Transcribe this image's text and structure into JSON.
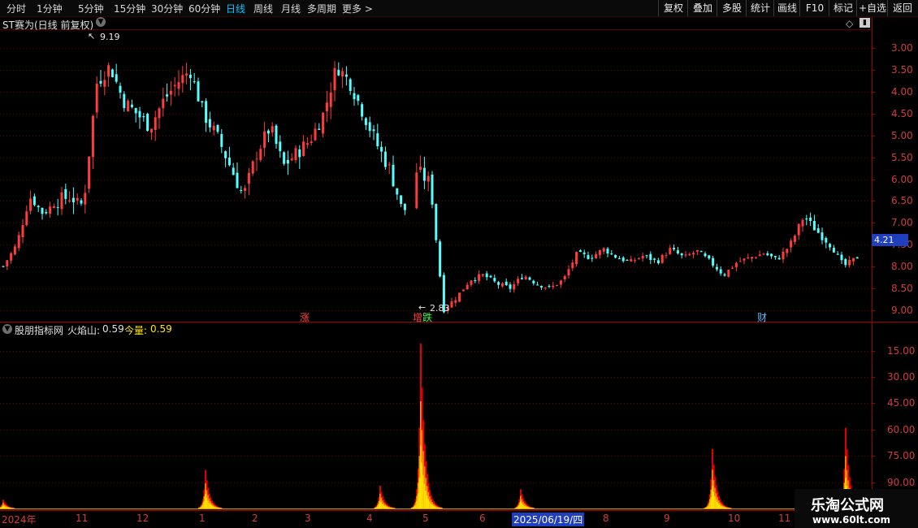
{
  "toolbar": {
    "periods": [
      "分时",
      "1分钟",
      "5分钟",
      "15分钟",
      "30分钟",
      "60分钟",
      "日线",
      "周线",
      "月线",
      "多周期",
      "更多 >"
    ],
    "active_period": "日线",
    "right_buttons": [
      "复权",
      "叠加",
      "多股",
      "统计",
      "画线",
      "F10",
      "标记",
      "+自选",
      "返回"
    ]
  },
  "main_panel": {
    "title": "ST赛为(日线 前复权)",
    "high_label": "9.19",
    "low_label": "2.83",
    "current_price": "4.21",
    "y_ticks": [
      "9.00",
      "8.50",
      "8.00",
      "7.50",
      "7.00",
      "6.50",
      "6.00",
      "5.50",
      "5.00",
      "4.50",
      "4.00",
      "3.50",
      "3.00"
    ],
    "event_markers": [
      "涨",
      "增",
      "跌",
      "财"
    ]
  },
  "indicator_panel": {
    "title": "股朋指标网",
    "line1_name": "火焰山:",
    "line1_value": "0.59",
    "line2_name": "今量:",
    "line2_value": "0.59",
    "y_ticks": [
      "90.00",
      "75.00",
      "60.00",
      "45.00",
      "30.00",
      "15.00"
    ]
  },
  "x_axis": {
    "labels": [
      "2024年",
      "11",
      "12",
      "1",
      "2",
      "3",
      "4",
      "5",
      "6",
      "2025/06/19/四",
      "8",
      "9",
      "10",
      "11"
    ]
  },
  "watermark": {
    "title": "乐淘公式网",
    "url": "www.60lt.com"
  },
  "colors": {
    "up": "#ff3c3c",
    "down": "#54ffff",
    "grid": "#6a0000",
    "current_price_bg": "#1f3fbf",
    "flame_red": "#e00000",
    "flame_orange": "#ff8c00",
    "flame_yellow": "#ffe600"
  },
  "icons": [
    "chevron-down-icon",
    "diamond-icon",
    "panel-toggle-icon",
    "collapse-icon"
  ],
  "chart_data": [
    {
      "type": "candlestick",
      "title": "ST赛为(日线 前复权)",
      "x_range": [
        "2024-10",
        "2025-11"
      ],
      "ylim": [
        2.75,
        9.4
      ],
      "y_ticks": [
        3.0,
        3.5,
        4.0,
        4.5,
        5.0,
        5.5,
        6.0,
        6.5,
        7.0,
        7.5,
        8.0,
        8.5,
        9.0
      ],
      "annotations": [
        {
          "text": "9.19",
          "kind": "period high"
        },
        {
          "text": "2.83",
          "kind": "period low"
        }
      ],
      "last_price": 4.21,
      "close_path": [
        {
          "x": "2024-10",
          "y": 4.0
        },
        {
          "x": "2024-10",
          "y": 4.5
        },
        {
          "x": "2024-10",
          "y": 5.6
        },
        {
          "x": "2024-10",
          "y": 5.2
        },
        {
          "x": "2024-10",
          "y": 5.5
        },
        {
          "x": "2024-11",
          "y": 5.6
        },
        {
          "x": "2024-11",
          "y": 5.4
        },
        {
          "x": "2024-11",
          "y": 8.2
        },
        {
          "x": "2024-11",
          "y": 8.6
        },
        {
          "x": "2024-11",
          "y": 7.8
        },
        {
          "x": "2024-12",
          "y": 7.5
        },
        {
          "x": "2024-12",
          "y": 7.2
        },
        {
          "x": "2024-12",
          "y": 7.8
        },
        {
          "x": "2024-12",
          "y": 8.2
        },
        {
          "x": "2025-01",
          "y": 8.5
        },
        {
          "x": "2025-01",
          "y": 7.5
        },
        {
          "x": "2025-01",
          "y": 7.0
        },
        {
          "x": "2025-01",
          "y": 6.3
        },
        {
          "x": "2025-02",
          "y": 5.6
        },
        {
          "x": "2025-02",
          "y": 6.6
        },
        {
          "x": "2025-02",
          "y": 7.2
        },
        {
          "x": "2025-02",
          "y": 6.3
        },
        {
          "x": "2025-02",
          "y": 6.6
        },
        {
          "x": "2025-03",
          "y": 6.9
        },
        {
          "x": "2025-03",
          "y": 7.5
        },
        {
          "x": "2025-03",
          "y": 8.6
        },
        {
          "x": "2025-03",
          "y": 8.2
        },
        {
          "x": "2025-04",
          "y": 7.5
        },
        {
          "x": "2025-04",
          "y": 6.8
        },
        {
          "x": "2025-04",
          "y": 6.2
        },
        {
          "x": "2025-04",
          "y": 5.2
        },
        {
          "x": "2025-04",
          "y": 6.2
        },
        {
          "x": "2025-04",
          "y": 5.9
        },
        {
          "x": "2025-05",
          "y": 3.0
        },
        {
          "x": "2025-05",
          "y": 3.3
        },
        {
          "x": "2025-05",
          "y": 3.7
        },
        {
          "x": "2025-05",
          "y": 3.8
        },
        {
          "x": "2025-06",
          "y": 3.6
        },
        {
          "x": "2025-06",
          "y": 3.5
        },
        {
          "x": "2025-06",
          "y": 3.8
        },
        {
          "x": "2025-06",
          "y": 3.6
        },
        {
          "x": "2025-06",
          "y": 3.5
        },
        {
          "x": "2025-07",
          "y": 3.7
        },
        {
          "x": "2025-07",
          "y": 4.3
        },
        {
          "x": "2025-07",
          "y": 4.2
        },
        {
          "x": "2025-07",
          "y": 4.4
        },
        {
          "x": "2025-07",
          "y": 4.2
        },
        {
          "x": "2025-08",
          "y": 4.1
        },
        {
          "x": "2025-08",
          "y": 4.25
        },
        {
          "x": "2025-08",
          "y": 4.1
        },
        {
          "x": "2025-08",
          "y": 4.4
        },
        {
          "x": "2025-09",
          "y": 4.2
        },
        {
          "x": "2025-09",
          "y": 4.35
        },
        {
          "x": "2025-09",
          "y": 4.1
        },
        {
          "x": "2025-09",
          "y": 3.8
        },
        {
          "x": "2025-10",
          "y": 4.1
        },
        {
          "x": "2025-10",
          "y": 4.2
        },
        {
          "x": "2025-10",
          "y": 4.3
        },
        {
          "x": "2025-10",
          "y": 4.15
        },
        {
          "x": "2025-10",
          "y": 4.5
        },
        {
          "x": "2025-11",
          "y": 5.15
        },
        {
          "x": "2025-11",
          "y": 4.8
        },
        {
          "x": "2025-11",
          "y": 4.5
        },
        {
          "x": "2025-11",
          "y": 4.0
        },
        {
          "x": "2025-11",
          "y": 4.21
        }
      ]
    },
    {
      "type": "bar",
      "title": "股朋指标网",
      "series": [
        {
          "name": "火焰山",
          "last_value": 0.59
        },
        {
          "name": "今量",
          "last_value": 0.59
        }
      ],
      "ylim": [
        0,
        100
      ],
      "y_ticks": [
        15,
        30,
        45,
        60,
        75,
        90
      ],
      "peaks": [
        {
          "x": "2024-10",
          "y": 5
        },
        {
          "x": "2025-01",
          "y": 22
        },
        {
          "x": "2025-04",
          "y": 13
        },
        {
          "x": "2025-05",
          "y": 94
        },
        {
          "x": "2025-06",
          "y": 11
        },
        {
          "x": "2025-09",
          "y": 34
        },
        {
          "x": "2025-11",
          "y": 46
        }
      ]
    }
  ]
}
